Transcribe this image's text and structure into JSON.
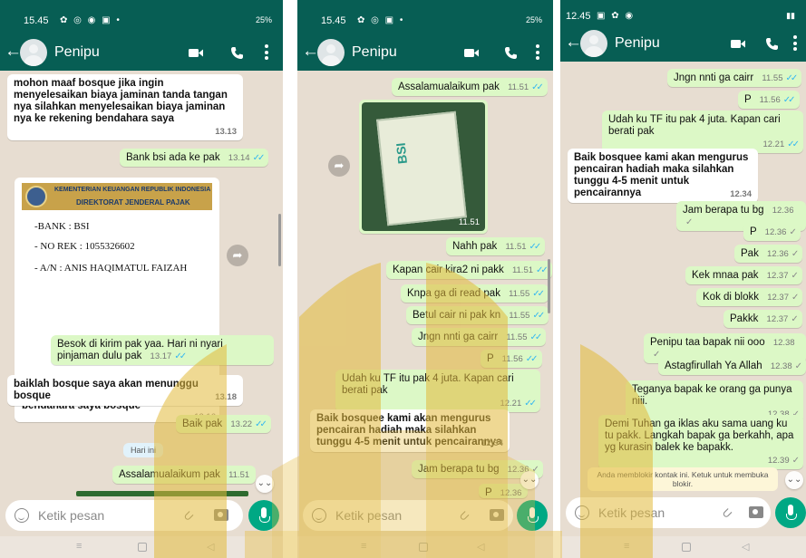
{
  "colors": {
    "header": "#075e54",
    "outgoing_bubble": "#dcf8c6",
    "incoming_bubble": "#ffffff",
    "chat_background": "#e7ddd1",
    "read_tick": "#34b7f1",
    "mic_button": "#00a884",
    "watermark": "#e2b93b"
  },
  "icons": {
    "status": "notification-icons",
    "back": "arrow-left-icon",
    "avatar": "default-avatar-icon",
    "video": "video-camera-icon",
    "call": "phone-icon",
    "menu": "three-dot-menu-icon",
    "emoji": "emoji-icon",
    "attach": "paperclip-icon",
    "camera": "camera-icon",
    "mic": "microphone-icon",
    "forward": "forward-icon",
    "scroll_down": "double-chevron-down-icon"
  },
  "composer": {
    "placeholder": "Ketik pesan"
  },
  "ticks": "✓✓",
  "tick_single": "✓",
  "phone1": {
    "status": {
      "time": "15.45",
      "battery": "25%"
    },
    "contact_name": "Penipu",
    "messages": [
      {
        "text": "mohon maaf bosque jika ingin menyelesaikan biaya jaminan tanda tangan nya silahkan menyelesaikan biaya jaminan nya ke rekening bendahara saya",
        "time": "13.13"
      },
      {
        "text": "Bank bsi ada ke pak",
        "time": "13.14"
      },
      {
        "text": "Besok di kirim pak yaa. Hari ni nyari pinjaman dulu pak",
        "time": "13.17"
      },
      {
        "text": "baiklah bosque saya akan menunggu bosque",
        "time": "13.18"
      },
      {
        "text": "Baik pak",
        "time": "13.22"
      },
      {
        "text": "Assalamualaikum pak",
        "time": "11.51"
      }
    ],
    "document": {
      "ministry": "KEMENTERIAN KEUANGAN REPUBLIK INDONESIA",
      "directorate": "DIREKTORAT JENDERAL PAJAK",
      "bank": "-BANK : BSI",
      "account": "- NO REK : 1055326602",
      "holder": "- A/N : ANIS HAQIMATUL FAIZAH",
      "caption": "baiklah bosque silahkan menyelesaikan biaya nya ke rekening bendahara saya bosque",
      "time": "13.16"
    },
    "date_chip": "Hari ini"
  },
  "phone2": {
    "status": {
      "time": "15.45",
      "battery": "25%"
    },
    "contact_name": "Penipu",
    "messages": [
      {
        "text": "Assalamualaikum pak",
        "time": "11.51"
      },
      {
        "text": "Nahh pak",
        "time": "11.51"
      },
      {
        "text": "Kapan cair kira2 ni pakk",
        "time": "11.51"
      },
      {
        "text": "Knpa ga di read pak",
        "time": "11.55"
      },
      {
        "text": "Betul cair ni pak kn",
        "time": "11.55"
      },
      {
        "text": "Jngn nnti ga cairr",
        "time": "11.55"
      },
      {
        "text": "P",
        "time": "11.56"
      },
      {
        "text": "Udah ku TF itu pak 4 juta. Kapan cari berati pak",
        "time": "12.21"
      },
      {
        "text": "Baik bosquee kami akan mengurus pencairan hadiah maka silahkan tunggu 4-5 menit untuk pencairannya",
        "time": "12.34"
      },
      {
        "text": "Jam berapa tu bg",
        "time": "12.36"
      },
      {
        "text": "P",
        "time": "12.36"
      }
    ],
    "image": {
      "label": "BSI",
      "time": "11.51"
    }
  },
  "phone3": {
    "status": {
      "time": "12.45"
    },
    "contact_name": "Penipu",
    "messages": [
      {
        "text": "Jngn nnti ga cairr",
        "time": "11.55"
      },
      {
        "text": "P",
        "time": "11.56"
      },
      {
        "text": "Udah ku TF itu pak 4 juta. Kapan cari berati pak",
        "time": "12.21"
      },
      {
        "text": "Baik bosquee kami akan mengurus pencairan hadiah maka silahkan tunggu 4-5 menit untuk pencairannya",
        "time": "12.34"
      },
      {
        "text": "Jam berapa tu bg",
        "time": "12.36"
      },
      {
        "text": "P",
        "time": "12.36"
      },
      {
        "text": "Pak",
        "time": "12.36"
      },
      {
        "text": "Kek mnaa pak",
        "time": "12.37"
      },
      {
        "text": "Kok di blokk",
        "time": "12.37"
      },
      {
        "text": "Pakkk",
        "time": "12.37"
      },
      {
        "text": "Penipu taa bapak nii ooo",
        "time": "12.38"
      },
      {
        "text": "Astagfirullah Ya Allah",
        "time": "12.38"
      },
      {
        "text": "Teganya bapak ke orang ga punya niii.",
        "time": "12.38"
      },
      {
        "text": "Demi Tuhan ga iklas aku sama uang ku tu pakk.  Langkah bapak ga berkahh, apa yg kurasin balek ke bapakk.",
        "time": "12.39"
      }
    ],
    "block_notice": "Anda memblokir kontak ini. Ketuk untuk membuka blokir."
  }
}
